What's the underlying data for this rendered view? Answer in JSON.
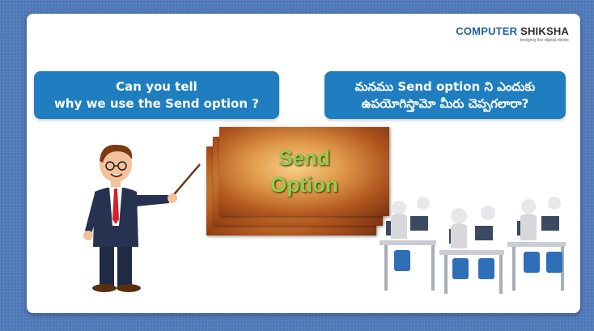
{
  "logo": {
    "part1": "COMPUTER",
    "part2": " SHIKSHA",
    "tagline": "bridging the digital divide"
  },
  "question_english": {
    "line1": "Can you tell",
    "line2": "why we use the Send option ?"
  },
  "question_telugu": {
    "line1": "మనము Send option ని ఎందుకు",
    "line2": "ఉపయోగిస్తామో మీరు చెప్పగలారా?"
  },
  "topic_card": {
    "line1": "Send",
    "line2": "Option"
  },
  "colors": {
    "background": "#4f78b8",
    "question_box": "#1f7ec0",
    "topic_text": "#8fd14a"
  },
  "icons": [
    "teacher-illustration",
    "computer-lab-illustration"
  ]
}
